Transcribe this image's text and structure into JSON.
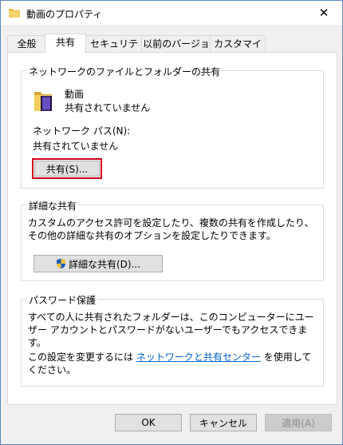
{
  "window": {
    "title": "動画のプロパティ",
    "close_symbol": "✕"
  },
  "tabs": [
    {
      "label": "全般"
    },
    {
      "label": "共有"
    },
    {
      "label": "セキュリティ"
    },
    {
      "label": "以前のバージョン"
    },
    {
      "label": "カスタマイズ"
    }
  ],
  "network_share": {
    "group_title": "ネットワークのファイルとフォルダーの共有",
    "folder_name": "動画",
    "folder_status": "共有されていません",
    "path_label": "ネットワーク パス(N):",
    "path_value": "共有されていません",
    "share_button": "共有(S)..."
  },
  "advanced_share": {
    "group_title": "詳細な共有",
    "description": "カスタムのアクセス許可を設定したり、複数の共有を作成したり、その他の詳細な共有のオプションを設定したりできます。",
    "button_label": "詳細な共有(D)..."
  },
  "password": {
    "group_title": "パスワード保護",
    "description": "すべての人に共有されたフォルダーは、このコンピューターにユーザー アカウントとパスワードがないユーザーでもアクセスできます。",
    "setting_prefix": "この設定を変更するには",
    "setting_link": "ネットワークと共有センター",
    "setting_suffix": "を使用してください。"
  },
  "footer": {
    "ok": "OK",
    "cancel": "キャンセル",
    "apply": "適用(A)"
  },
  "icons": {
    "title": "folder-icon",
    "folder": "video-folder-icon",
    "shield": "uac-shield-icon"
  }
}
